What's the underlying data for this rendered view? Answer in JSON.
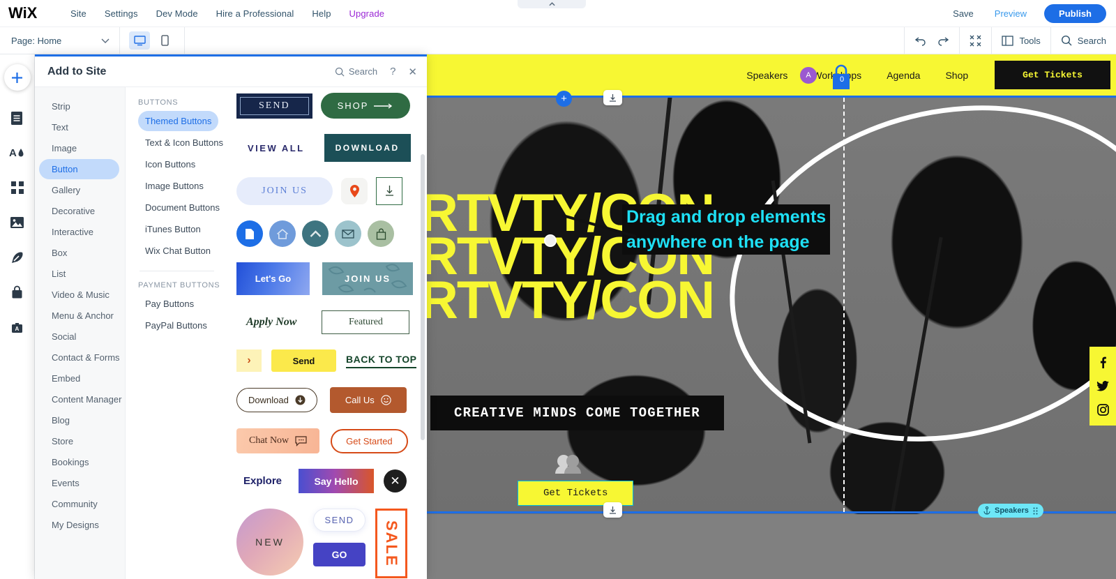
{
  "topbar": {
    "logo": "WiX",
    "menu": [
      {
        "label": "Site"
      },
      {
        "label": "Settings"
      },
      {
        "label": "Dev Mode"
      },
      {
        "label": "Hire a Professional"
      },
      {
        "label": "Help"
      },
      {
        "label": "Upgrade"
      }
    ],
    "save_label": "Save",
    "preview_label": "Preview",
    "publish_label": "Publish"
  },
  "toolbar": {
    "page_label": "Page: Home",
    "desktop_icon": "desktop-icon",
    "mobile_icon": "mobile-icon",
    "undo_icon": "undo-icon",
    "redo_icon": "redo-icon",
    "zoomout_icon": "zoom-out-icon",
    "tools_label": "Tools",
    "search_label": "Search"
  },
  "rail": {
    "add_icon": "plus-icon",
    "items": [
      {
        "icon": "pages-icon",
        "name": "pages"
      },
      {
        "icon": "theme-icon",
        "name": "design"
      },
      {
        "icon": "apps-grid-icon",
        "name": "apps"
      },
      {
        "icon": "media-image-icon",
        "name": "media"
      },
      {
        "icon": "blog-pen-icon",
        "name": "blog"
      },
      {
        "icon": "store-bag-icon",
        "name": "store"
      },
      {
        "icon": "content-box-icon",
        "name": "content"
      }
    ]
  },
  "panel": {
    "title": "Add to Site",
    "search_label": "Search",
    "help_label": "?",
    "close_label": "✕",
    "categories": [
      {
        "label": "Strip",
        "active": false
      },
      {
        "label": "Text",
        "active": false
      },
      {
        "label": "Image",
        "active": false
      },
      {
        "label": "Button",
        "active": true
      },
      {
        "label": "Gallery",
        "active": false
      },
      {
        "label": "Decorative",
        "active": false
      },
      {
        "label": "Interactive",
        "active": false
      },
      {
        "label": "Box",
        "active": false
      },
      {
        "label": "List",
        "active": false
      },
      {
        "label": "Video & Music",
        "active": false
      },
      {
        "label": "Menu & Anchor",
        "active": false
      },
      {
        "label": "Social",
        "active": false
      },
      {
        "label": "Contact & Forms",
        "active": false
      },
      {
        "label": "Embed",
        "active": false
      },
      {
        "label": "Content Manager",
        "active": false
      },
      {
        "label": "Blog",
        "active": false
      },
      {
        "label": "Store",
        "active": false
      },
      {
        "label": "Bookings",
        "active": false
      },
      {
        "label": "Events",
        "active": false
      },
      {
        "label": "Community",
        "active": false
      },
      {
        "label": "My Designs",
        "active": false
      }
    ],
    "sub_groups": [
      {
        "heading": "BUTTONS",
        "items": [
          {
            "label": "Themed Buttons",
            "active": true
          },
          {
            "label": "Text & Icon Buttons",
            "active": false
          },
          {
            "label": "Icon Buttons",
            "active": false
          },
          {
            "label": "Image Buttons",
            "active": false
          },
          {
            "label": "Document Buttons",
            "active": false
          },
          {
            "label": "iTunes Button",
            "active": false
          },
          {
            "label": "Wix Chat Button",
            "active": false
          }
        ]
      },
      {
        "heading": "PAYMENT BUTTONS",
        "items": [
          {
            "label": "Pay Buttons",
            "active": false
          },
          {
            "label": "PayPal Buttons",
            "active": false
          }
        ]
      }
    ],
    "gallery_buttons": [
      {
        "label": "SEND",
        "style": "send-navy"
      },
      {
        "label": "SHOP",
        "style": "shop-green",
        "icon": "arrow-right-icon"
      },
      {
        "label": "VIEW ALL",
        "style": "view-all"
      },
      {
        "label": "DOWNLOAD",
        "style": "download-teal"
      },
      {
        "label": "JOIN US",
        "style": "joinus-lavender"
      },
      {
        "label": "",
        "style": "pin",
        "icon": "location-pin-icon"
      },
      {
        "label": "",
        "style": "dl-square",
        "icon": "download-arrow-icon"
      },
      {
        "label": "",
        "style": "circle-blue",
        "icon": "document-icon"
      },
      {
        "label": "",
        "style": "circle-lightblue",
        "icon": "home-icon"
      },
      {
        "label": "",
        "style": "circle-teal",
        "icon": "chevron-up-icon"
      },
      {
        "label": "",
        "style": "circle-steel",
        "icon": "mail-icon"
      },
      {
        "label": "",
        "style": "circle-sage",
        "icon": "shopping-bag-icon"
      },
      {
        "label": "Let's Go",
        "style": "lets-go"
      },
      {
        "label": "JOIN US",
        "style": "joinus-floral"
      },
      {
        "label": "Apply Now",
        "style": "apply-now"
      },
      {
        "label": "Featured",
        "style": "featured"
      },
      {
        "label": "›",
        "style": "arrow-yellow"
      },
      {
        "label": "Send",
        "style": "send-yellow"
      },
      {
        "label": "BACK TO TOP",
        "style": "back-to-top"
      },
      {
        "label": "Download",
        "style": "download-pill",
        "icon": "download-circle-icon"
      },
      {
        "label": "Call Us",
        "style": "call-us",
        "icon": "smiley-icon"
      },
      {
        "label": "Chat Now",
        "style": "chat-now",
        "icon": "chat-bubble-icon"
      },
      {
        "label": "Get Started",
        "style": "get-started"
      },
      {
        "label": "Explore",
        "style": "explore"
      },
      {
        "label": "Say Hello",
        "style": "say-hello"
      },
      {
        "label": "✕",
        "style": "close-x"
      },
      {
        "label": "NEW",
        "style": "new-circle"
      },
      {
        "label": "SEND",
        "style": "send-outline"
      },
      {
        "label": "GO",
        "style": "go-indigo"
      },
      {
        "label": "SALE",
        "style": "sale-vertical"
      }
    ]
  },
  "canvas": {
    "site_nav": {
      "links": [
        {
          "label": "Speakers"
        },
        {
          "label": "Workshops"
        },
        {
          "label": "Agenda"
        },
        {
          "label": "Shop"
        }
      ],
      "avatar_letter": "A",
      "cart_icon": "shopping-cart-icon",
      "cart_count": "0",
      "cta_label": "Get Tickets",
      "bg_color": "#f7f733"
    },
    "hero": {
      "title_lines": [
        "RTVTY/CON",
        "RTVTY/CON",
        "RTVTY/CON"
      ],
      "title_color": "#f7f733",
      "tagline": "CREATIVE MINDS COME TOGETHER",
      "people_icon": "people-icon",
      "cta_label": "Get Tickets",
      "cta_color": "#f7f733"
    },
    "social": [
      {
        "icon": "facebook-icon"
      },
      {
        "icon": "twitter-icon"
      },
      {
        "icon": "instagram-icon"
      }
    ],
    "anchor_chip": {
      "label": "Speakers",
      "icon": "anchor-icon"
    },
    "section_plus_icon": "plus-icon",
    "section_download_icon": "download-icon",
    "selection_color": "#1d6ee6"
  },
  "drag_ghost": {
    "line1": "Drag and drop elements",
    "line2": "anywhere on the page",
    "text_color": "#1ee0f5",
    "bg_color": "#0d0d0d"
  }
}
